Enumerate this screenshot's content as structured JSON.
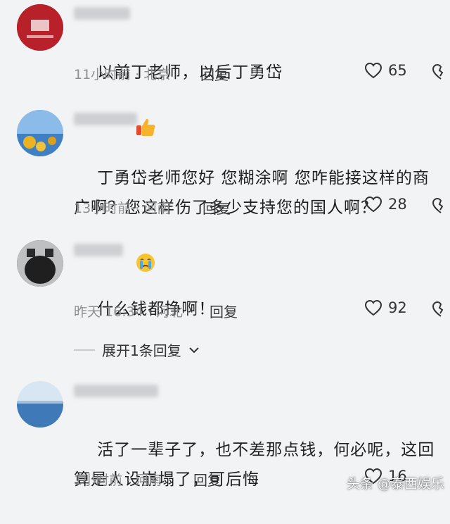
{
  "comments": [
    {
      "text": "以前丁老师，以后丁勇岱",
      "emoji": "thumbs-up-icon",
      "time_location": "11小时前 · 北京",
      "reply": "回复",
      "likes": "65"
    },
    {
      "text": "丁勇岱老师您好 您糊涂啊 您咋能接这样的商广啊？您这样伤了多少支持您的国人啊？",
      "emoji": "crying-face-icon",
      "time_location": "13小时前 · 河南",
      "reply": "回复",
      "likes": "28"
    },
    {
      "text": "什么钱都挣啊！",
      "time_location": "昨天 16:34 · 河北",
      "reply": "回复",
      "likes": "92",
      "expand_label": "展开1条回复"
    },
    {
      "text": "活了一辈子了，也不差那点钱，何必呢，这回算是人设崩塌了，可后悔",
      "time_location": "1小时前 · 河南",
      "reply": "回复",
      "likes": "16"
    }
  ],
  "watermark": "头条 @泰西娱乐",
  "colors": {
    "background": "#f2f3f5",
    "meta": "#8d8f93",
    "text": "#202020"
  }
}
